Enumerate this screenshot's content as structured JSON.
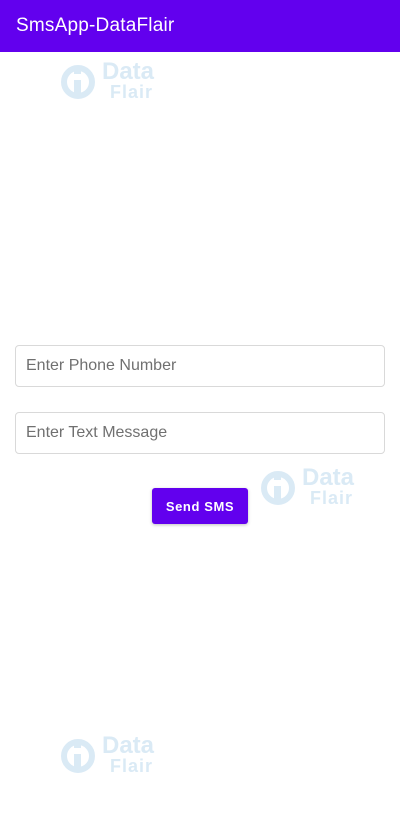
{
  "app_bar": {
    "title": "SmsApp-DataFlair",
    "color": "#6200ee"
  },
  "form": {
    "phone_input": {
      "placeholder": "Enter Phone Number",
      "value": ""
    },
    "message_input": {
      "placeholder": "Enter Text Message",
      "value": ""
    },
    "send_button": {
      "label": "Send SMS",
      "color": "#6200ee"
    }
  },
  "watermark": {
    "word1": "Data",
    "word2": "Flair",
    "icon": "dataflair-logo-icon",
    "color": "#bcd9ee"
  }
}
